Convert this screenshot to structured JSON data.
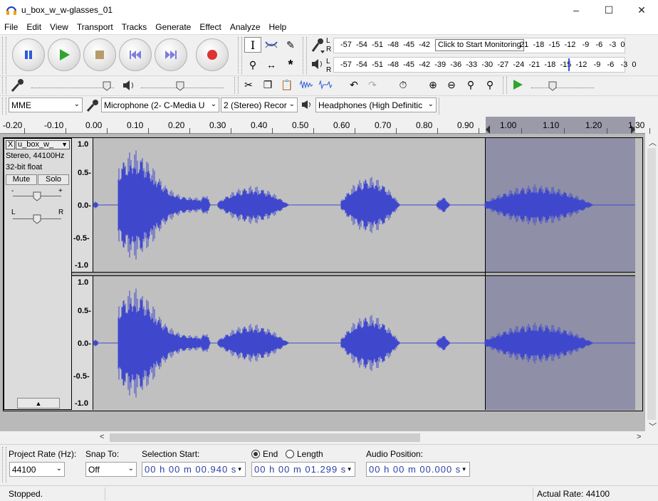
{
  "window": {
    "title": "u_box_w_w-glasses_01",
    "minimize": "–",
    "maximize": "☐",
    "close": "✕"
  },
  "menu": [
    "File",
    "Edit",
    "View",
    "Transport",
    "Tracks",
    "Generate",
    "Effect",
    "Analyze",
    "Help"
  ],
  "meters": {
    "record_scale": [
      "-57",
      "-54",
      "-51",
      "-48",
      "-45",
      "-42",
      "-3",
      "21",
      "-18",
      "-15",
      "-12",
      "-9",
      "-6",
      "-3",
      "0"
    ],
    "monitor_tooltip": "Click to Start Monitoring",
    "play_scale": [
      "-57",
      "-54",
      "-51",
      "-48",
      "-45",
      "-42",
      "-39",
      "-36",
      "-33",
      "-30",
      "-27",
      "-24",
      "-21",
      "-18",
      "-15",
      "-12",
      "-9",
      "-6",
      "-3",
      "0"
    ],
    "L": "L",
    "R": "R"
  },
  "device": {
    "host": "MME",
    "input": "Microphone (2- C-Media U",
    "channels": "2 (Stereo) Recor",
    "output": "Headphones (High Definitic"
  },
  "ruler": [
    "-0.20",
    "-0.10",
    "0.00",
    "0.10",
    "0.20",
    "0.30",
    "0.40",
    "0.50",
    "0.60",
    "0.70",
    "0.80",
    "0.90",
    "1.00",
    "1.10",
    "1.20",
    "1.30"
  ],
  "track": {
    "name": "u_box_w_",
    "info1": "Stereo, 44100Hz",
    "info2": "32-bit float",
    "mute": "Mute",
    "solo": "Solo",
    "gain_minus": "-",
    "gain_plus": "+",
    "pan_l": "L",
    "pan_r": "R",
    "close": "X",
    "menu_arrow": "▼",
    "collapse": "▲",
    "scale": [
      "1.0",
      "0.5-",
      "0.0-",
      "-0.5-",
      "-1.0"
    ]
  },
  "bottom": {
    "project_rate_label": "Project Rate (Hz):",
    "project_rate": "44100",
    "snap_label": "Snap To:",
    "snap_value": "Off",
    "selection_start_label": "Selection Start:",
    "end_label": "End",
    "length_label": "Length",
    "audio_position_label": "Audio Position:",
    "selection_start": "00 h 00 m 00.940 s",
    "selection_end": "00 h 00 m 01.299 s",
    "audio_position": "00 h 00 m 00.000 s"
  },
  "status": {
    "left": "Stopped.",
    "right": "Actual Rate: 44100"
  },
  "colors": {
    "waveform": "#3f48cc",
    "selection": "#8f8fa8",
    "background": "#c0c0c0"
  }
}
